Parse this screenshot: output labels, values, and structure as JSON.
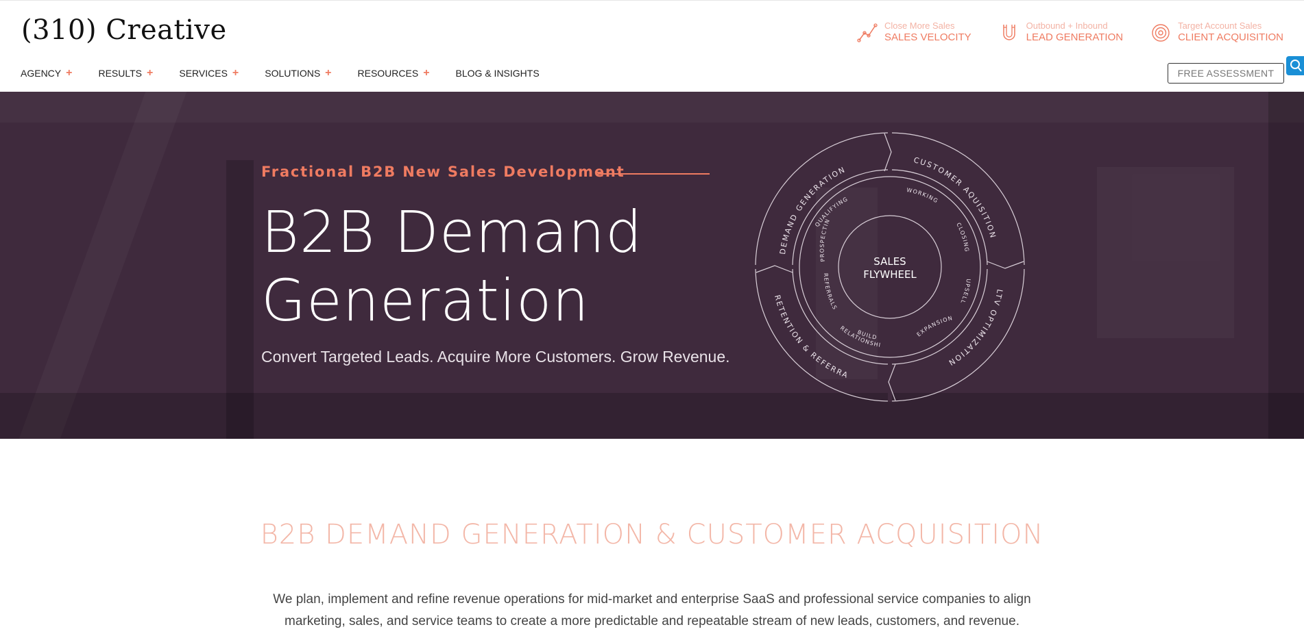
{
  "brand": {
    "logo": "(310) Creative"
  },
  "top_links": [
    {
      "small": "Close More Sales",
      "big": "SALES VELOCITY",
      "icon": "trend-chart-icon"
    },
    {
      "small": "Outbound + Inbound",
      "big": "LEAD GENERATION",
      "icon": "magnet-icon"
    },
    {
      "small": "Target Account Sales",
      "big": "CLIENT ACQUISITION",
      "icon": "target-icon"
    }
  ],
  "nav": {
    "items": [
      {
        "label": "AGENCY",
        "plus": "+"
      },
      {
        "label": "RESULTS",
        "plus": "+"
      },
      {
        "label": "SERVICES",
        "plus": "+"
      },
      {
        "label": "SOLUTIONS",
        "plus": "+"
      },
      {
        "label": "RESOURCES",
        "plus": "+"
      },
      {
        "label": "BLOG & INSIGHTS",
        "plus": ""
      }
    ],
    "cta": "FREE ASSESSMENT"
  },
  "hero": {
    "eyebrow": "Fractional B2B New Sales Development",
    "title_line1": "B2B Demand",
    "title_line2": "Generation",
    "subtitle": "Convert Targeted Leads. Acquire More Customers. Grow Revenue."
  },
  "flywheel": {
    "center_line1": "SALES",
    "center_line2": "FLYWHEEL",
    "outer": [
      "DEMAND GENERATION",
      "CUSTOMER AQUISITION",
      "LTV OPTIMIZATION",
      "RETENTION & REFERRAL"
    ],
    "inner": [
      "QUALIFYING",
      "WORKING",
      "CLOSING",
      "UPSELL",
      "EXPANSION",
      "BUILD",
      "RELATIONSHIPS",
      "REFERRALS",
      "PROSPECTING"
    ]
  },
  "section": {
    "title": "B2B DEMAND GENERATION & CUSTOMER ACQUISITION",
    "body": "We plan, implement and refine revenue operations for mid-market and enterprise SaaS and professional service companies to align marketing, sales, and service teams to create a more predictable and repeatable stream of new leads, customers, and revenue."
  },
  "colors": {
    "accent": "#ef7b61",
    "hero_bg": "#3f2a3d",
    "accent_light": "#f3b7a8"
  }
}
